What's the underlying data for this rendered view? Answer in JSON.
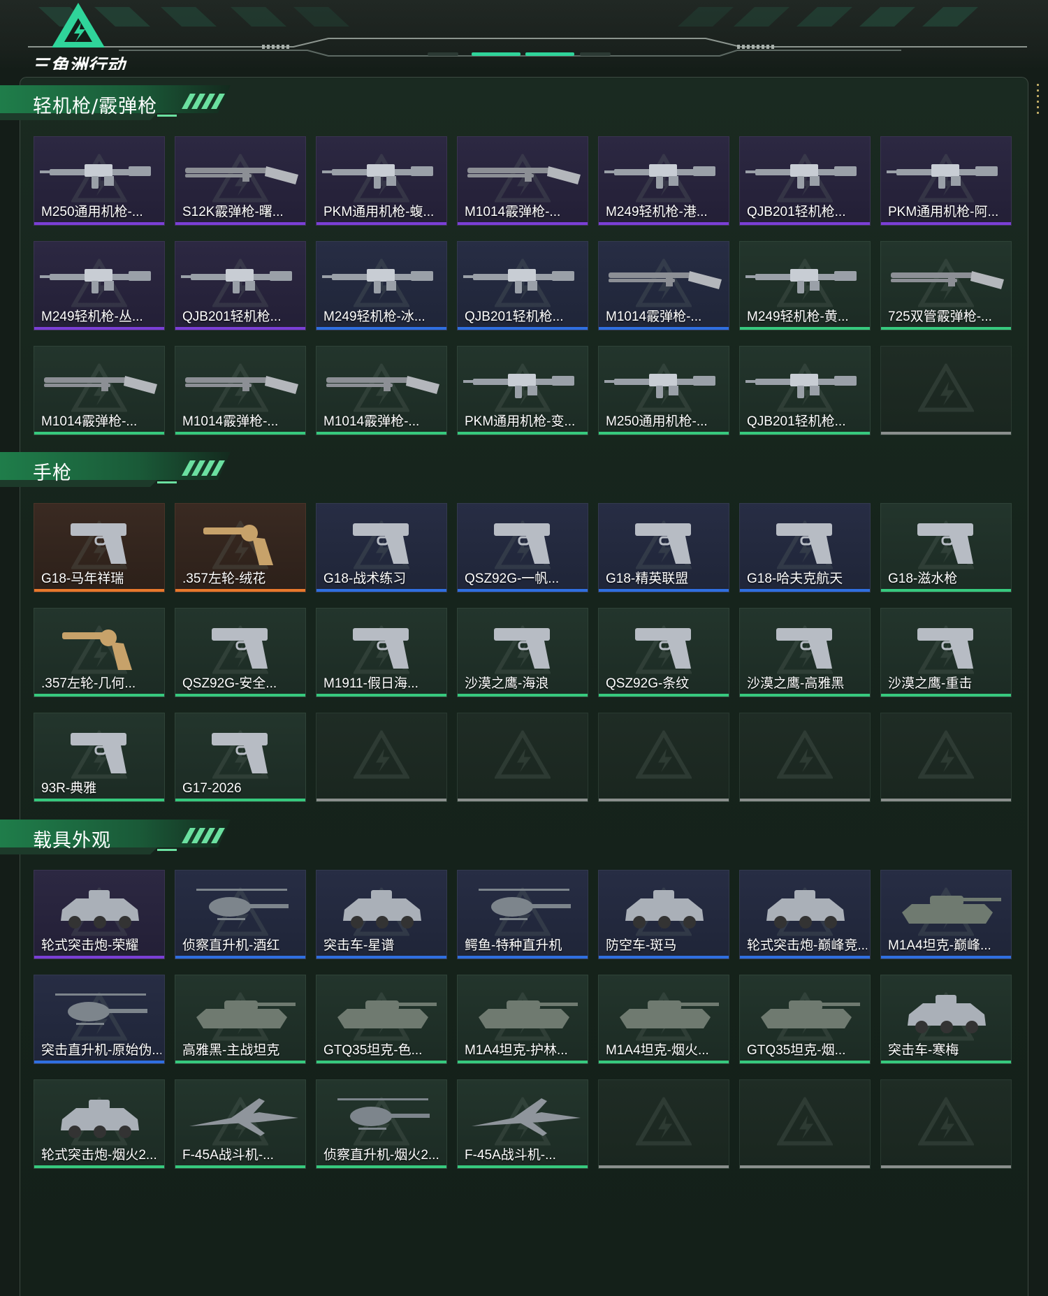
{
  "app": {
    "logo_text": "三角洲行动"
  },
  "colors": {
    "purple": "#7b3fd6",
    "blue": "#2f6fe0",
    "green": "#37c97e",
    "orange": "#e8782c",
    "accent": "#2fd49a"
  },
  "sections": [
    {
      "title": "轻机枪/霰弹枪",
      "items": [
        {
          "label": "M250通用机枪-...",
          "rarity": "purple",
          "icon": "machine-gun-icon"
        },
        {
          "label": "S12K霰弹枪-曙...",
          "rarity": "purple",
          "icon": "shotgun-icon"
        },
        {
          "label": "PKM通用机枪-蝮...",
          "rarity": "purple",
          "icon": "machine-gun-icon"
        },
        {
          "label": "M1014霰弹枪-...",
          "rarity": "purple",
          "icon": "shotgun-icon"
        },
        {
          "label": "M249轻机枪-港...",
          "rarity": "purple",
          "icon": "machine-gun-icon"
        },
        {
          "label": "QJB201轻机枪...",
          "rarity": "purple",
          "icon": "machine-gun-icon"
        },
        {
          "label": "PKM通用机枪-阿...",
          "rarity": "purple",
          "icon": "machine-gun-icon"
        },
        {
          "label": "M249轻机枪-丛...",
          "rarity": "purple",
          "icon": "machine-gun-icon"
        },
        {
          "label": "QJB201轻机枪...",
          "rarity": "purple",
          "icon": "machine-gun-icon"
        },
        {
          "label": "M249轻机枪-冰...",
          "rarity": "blue",
          "icon": "machine-gun-icon"
        },
        {
          "label": "QJB201轻机枪...",
          "rarity": "blue",
          "icon": "machine-gun-icon"
        },
        {
          "label": "M1014霰弹枪-...",
          "rarity": "blue",
          "icon": "shotgun-icon"
        },
        {
          "label": "M249轻机枪-黄...",
          "rarity": "green",
          "icon": "machine-gun-icon"
        },
        {
          "label": "725双管霰弹枪-...",
          "rarity": "green",
          "icon": "shotgun-icon"
        },
        {
          "label": "M1014霰弹枪-...",
          "rarity": "green",
          "icon": "shotgun-icon"
        },
        {
          "label": "M1014霰弹枪-...",
          "rarity": "green",
          "icon": "shotgun-icon"
        },
        {
          "label": "M1014霰弹枪-...",
          "rarity": "green",
          "icon": "shotgun-icon"
        },
        {
          "label": "PKM通用机枪-变...",
          "rarity": "green",
          "icon": "machine-gun-icon"
        },
        {
          "label": "M250通用机枪-...",
          "rarity": "green",
          "icon": "machine-gun-icon"
        },
        {
          "label": "QJB201轻机枪...",
          "rarity": "green",
          "icon": "machine-gun-icon"
        },
        {
          "label": "",
          "rarity": "empty",
          "icon": ""
        }
      ]
    },
    {
      "title": "手枪",
      "items": [
        {
          "label": "G18-马年祥瑞",
          "rarity": "orange",
          "icon": "pistol-icon"
        },
        {
          "label": ".357左轮-绒花",
          "rarity": "orange",
          "icon": "revolver-icon"
        },
        {
          "label": "G18-战术练习",
          "rarity": "blue",
          "icon": "pistol-icon"
        },
        {
          "label": "QSZ92G-一帆...",
          "rarity": "blue",
          "icon": "pistol-icon"
        },
        {
          "label": "G18-精英联盟",
          "rarity": "blue",
          "icon": "pistol-icon"
        },
        {
          "label": "G18-哈夫克航天",
          "rarity": "blue",
          "icon": "pistol-icon"
        },
        {
          "label": "G18-滋水枪",
          "rarity": "green",
          "icon": "pistol-icon"
        },
        {
          "label": ".357左轮-几何...",
          "rarity": "green",
          "icon": "revolver-icon"
        },
        {
          "label": "QSZ92G-安全...",
          "rarity": "green",
          "icon": "pistol-icon"
        },
        {
          "label": "M1911-假日海...",
          "rarity": "green",
          "icon": "pistol-icon"
        },
        {
          "label": "沙漠之鹰-海浪",
          "rarity": "green",
          "icon": "pistol-icon"
        },
        {
          "label": "QSZ92G-条纹",
          "rarity": "green",
          "icon": "pistol-icon"
        },
        {
          "label": "沙漠之鹰-高雅黑",
          "rarity": "green",
          "icon": "pistol-icon"
        },
        {
          "label": "沙漠之鹰-重击",
          "rarity": "green",
          "icon": "pistol-icon"
        },
        {
          "label": "93R-典雅",
          "rarity": "green",
          "icon": "pistol-icon"
        },
        {
          "label": "G17-2026",
          "rarity": "green",
          "icon": "pistol-icon"
        },
        {
          "label": "",
          "rarity": "empty",
          "icon": ""
        },
        {
          "label": "",
          "rarity": "empty",
          "icon": ""
        },
        {
          "label": "",
          "rarity": "empty",
          "icon": ""
        },
        {
          "label": "",
          "rarity": "empty",
          "icon": ""
        },
        {
          "label": "",
          "rarity": "empty",
          "icon": ""
        }
      ]
    },
    {
      "title": "载具外观",
      "items": [
        {
          "label": "轮式突击炮-荣耀",
          "rarity": "purple",
          "icon": "armored-car-icon"
        },
        {
          "label": "侦察直升机-酒红",
          "rarity": "blue",
          "icon": "helicopter-icon"
        },
        {
          "label": "突击车-星谱",
          "rarity": "blue",
          "icon": "armored-car-icon"
        },
        {
          "label": "鳄鱼-特种直升机",
          "rarity": "blue",
          "icon": "helicopter-icon"
        },
        {
          "label": "防空车-斑马",
          "rarity": "blue",
          "icon": "armored-car-icon"
        },
        {
          "label": "轮式突击炮-巅峰竞...",
          "rarity": "blue",
          "icon": "armored-car-icon"
        },
        {
          "label": "M1A4坦克-巅峰...",
          "rarity": "blue",
          "icon": "tank-icon"
        },
        {
          "label": "突击直升机-原始伪...",
          "rarity": "blue",
          "icon": "helicopter-icon"
        },
        {
          "label": "高雅黑-主战坦克",
          "rarity": "green",
          "icon": "tank-icon"
        },
        {
          "label": "GTQ35坦克-色...",
          "rarity": "green",
          "icon": "tank-icon"
        },
        {
          "label": "M1A4坦克-护林...",
          "rarity": "green",
          "icon": "tank-icon"
        },
        {
          "label": "M1A4坦克-烟火...",
          "rarity": "green",
          "icon": "tank-icon"
        },
        {
          "label": "GTQ35坦克-烟...",
          "rarity": "green",
          "icon": "tank-icon"
        },
        {
          "label": "突击车-寒梅",
          "rarity": "green",
          "icon": "armored-car-icon"
        },
        {
          "label": "轮式突击炮-烟火2...",
          "rarity": "green",
          "icon": "armored-car-icon"
        },
        {
          "label": "F-45A战斗机-...",
          "rarity": "green",
          "icon": "jet-icon"
        },
        {
          "label": "侦察直升机-烟火2...",
          "rarity": "green",
          "icon": "helicopter-icon"
        },
        {
          "label": "F-45A战斗机-...",
          "rarity": "green",
          "icon": "jet-icon"
        },
        {
          "label": "",
          "rarity": "empty",
          "icon": ""
        },
        {
          "label": "",
          "rarity": "empty",
          "icon": ""
        },
        {
          "label": "",
          "rarity": "empty",
          "icon": ""
        }
      ]
    }
  ]
}
